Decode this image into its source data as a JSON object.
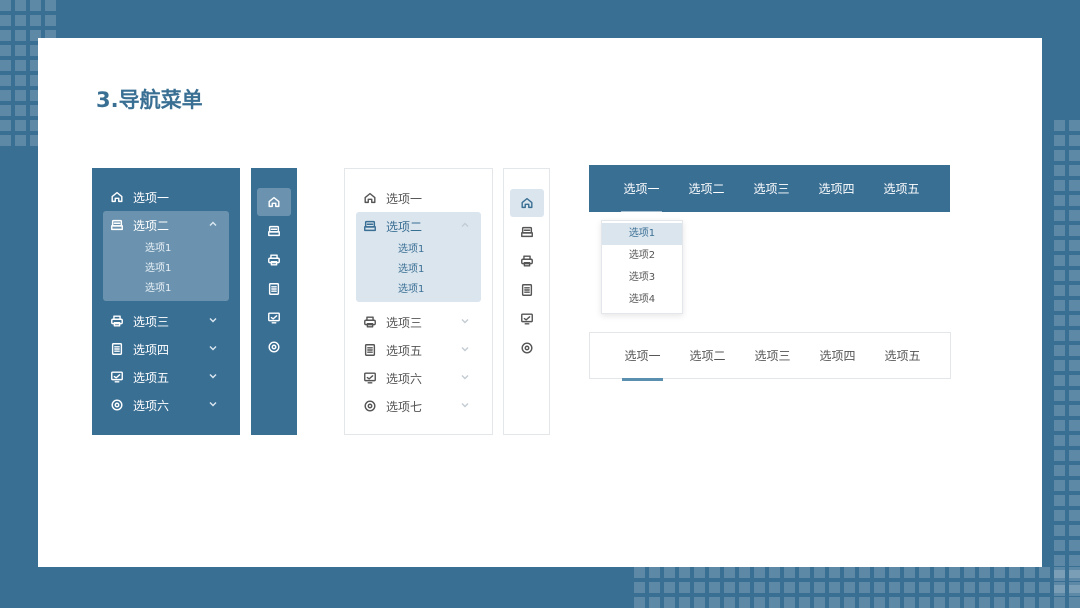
{
  "page": {
    "title": "3.导航菜单"
  },
  "dark_menu": {
    "items": [
      {
        "label": "选项一",
        "icon": "home-icon"
      },
      {
        "label": "选项二",
        "icon": "inbox-icon",
        "subitems": [
          "选项1",
          "选项1",
          "选项1"
        ]
      },
      {
        "label": "选项三",
        "icon": "printer-icon"
      },
      {
        "label": "选项四",
        "icon": "document-icon"
      },
      {
        "label": "选项五",
        "icon": "monitor-icon"
      },
      {
        "label": "选项六",
        "icon": "settings-icon"
      }
    ]
  },
  "light_menu": {
    "items": [
      {
        "label": "选项一",
        "icon": "home-icon"
      },
      {
        "label": "选项二",
        "icon": "inbox-icon",
        "subitems": [
          "选项1",
          "选项1",
          "选项1"
        ]
      },
      {
        "label": "选项三",
        "icon": "printer-icon"
      },
      {
        "label": "选项五",
        "icon": "document-icon"
      },
      {
        "label": "选项六",
        "icon": "monitor-icon"
      },
      {
        "label": "选项七",
        "icon": "settings-icon"
      }
    ]
  },
  "rail_icons": [
    "home-icon",
    "inbox-icon",
    "printer-icon",
    "document-icon",
    "monitor-icon",
    "settings-icon"
  ],
  "top_tabs": [
    "选项一",
    "选项二",
    "选项三",
    "选项四",
    "选项五"
  ],
  "dropdown": [
    "选项1",
    "选项2",
    "选项3",
    "选项4"
  ],
  "bottom_tabs": [
    "选项一",
    "选项二",
    "选项三",
    "选项四",
    "选项五"
  ],
  "colors": {
    "primary": "#3a6f94",
    "highlight": "#dbe5ee",
    "background": "#ffffff"
  }
}
